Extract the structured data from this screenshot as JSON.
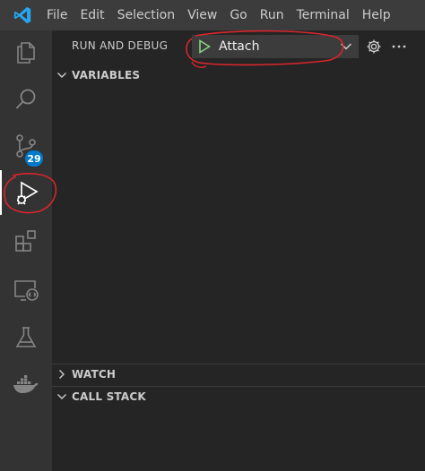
{
  "menu": {
    "items": [
      "File",
      "Edit",
      "Selection",
      "View",
      "Go",
      "Run",
      "Terminal",
      "Help"
    ]
  },
  "activity_bar": {
    "items": [
      {
        "name": "explorer",
        "icon": "files-icon"
      },
      {
        "name": "search",
        "icon": "search-icon"
      },
      {
        "name": "source-control",
        "icon": "source-control-icon",
        "badge": "29"
      },
      {
        "name": "run-and-debug",
        "icon": "run-debug-icon",
        "active": true
      },
      {
        "name": "extensions",
        "icon": "extensions-icon"
      },
      {
        "name": "remote-explorer",
        "icon": "remote-explorer-icon"
      },
      {
        "name": "testing",
        "icon": "flask-icon"
      },
      {
        "name": "docker",
        "icon": "docker-icon"
      }
    ]
  },
  "debug": {
    "header_title": "RUN AND DEBUG",
    "config_label": "Attach",
    "sections": {
      "variables": "VARIABLES",
      "watch": "WATCH",
      "call_stack": "CALL STACK"
    }
  },
  "colors": {
    "accent": "#007acc",
    "play_green": "#89d185",
    "annotation_red": "#d9262c"
  }
}
